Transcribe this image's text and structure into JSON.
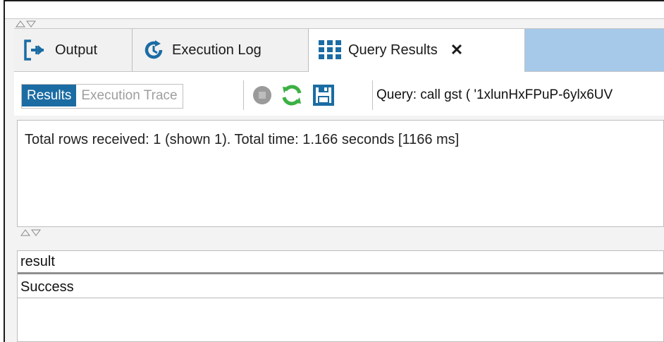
{
  "tabs": [
    {
      "label": "Output",
      "icon": "output-exit-icon",
      "active": false
    },
    {
      "label": "Execution Log",
      "icon": "clock-history-icon",
      "active": false
    },
    {
      "label": "Query Results",
      "icon": "grid-icon",
      "active": true,
      "close_label": "✕"
    }
  ],
  "toolbar": {
    "results_label": "Results",
    "execution_trace_label": "Execution Trace",
    "stop_icon": "stop-icon",
    "refresh_icon": "refresh-icon",
    "save_icon": "save-icon",
    "query_text": "Query: call gst ( '1xlunHxFPuP-6ylx6UV"
  },
  "status": {
    "text": "Total rows received: 1 (shown 1). Total time: 1.166 seconds [1166 ms]"
  },
  "grid": {
    "columns": [
      "result"
    ],
    "rows": [
      [
        "Success"
      ]
    ]
  },
  "colors": {
    "accent": "#1b6ca3",
    "tab_fill": "#a6c9ea",
    "icon_blue": "#1b6ca3",
    "refresh_green": "#3cb043"
  }
}
